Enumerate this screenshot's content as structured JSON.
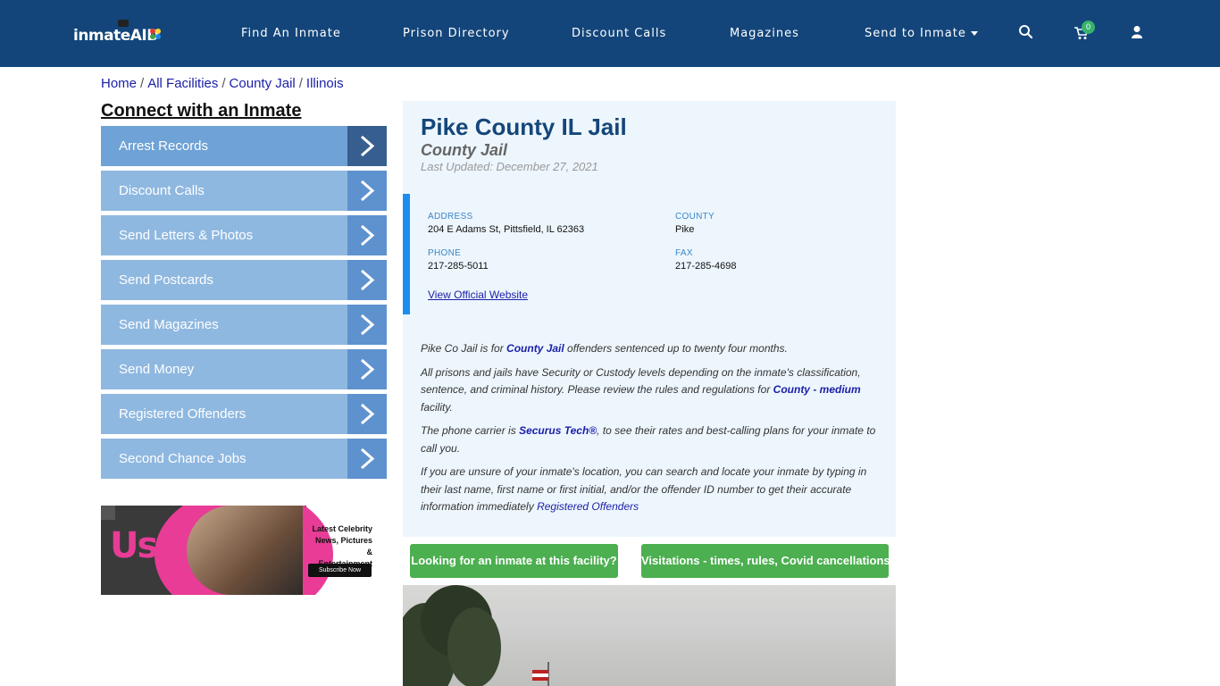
{
  "nav": {
    "logo_text": "inmateAID",
    "links": [
      "Find An Inmate",
      "Prison Directory",
      "Discount Calls",
      "Magazines",
      "Send to Inmate"
    ],
    "cart_count": "0",
    "icons": [
      "search-icon",
      "cart-icon",
      "user-icon"
    ]
  },
  "breadcrumb": [
    "Home",
    "All Facilities",
    "County Jail",
    "Illinois"
  ],
  "sidebar": {
    "title": "Connect with an Inmate",
    "items": [
      {
        "label": "Arrest Records"
      },
      {
        "label": "Discount Calls"
      },
      {
        "label": "Send Letters & Photos"
      },
      {
        "label": "Send Postcards"
      },
      {
        "label": "Send Magazines"
      },
      {
        "label": "Send Money"
      },
      {
        "label": "Registered Offenders"
      },
      {
        "label": "Second Chance Jobs"
      }
    ]
  },
  "ad": {
    "brand": "Us",
    "copy_line1": "Latest Celebrity",
    "copy_line2": "News, Pictures &",
    "copy_line3": "Entertainment",
    "button": "Subscribe Now"
  },
  "facility": {
    "name": "Pike County IL Jail",
    "type": "County Jail",
    "updated": "Last Updated: December 27, 2021",
    "address_label": "ADDRESS",
    "address": "204 E Adams St, Pittsfield, IL 62363",
    "county_label": "COUNTY",
    "county": "Pike",
    "phone_label": "PHONE",
    "phone": "217-285-5011",
    "fax_label": "FAX",
    "fax": "217-285-4698",
    "website_link": "View Official Website"
  },
  "description": {
    "p1_pre": "Pike Co Jail is for ",
    "p1_link": "County Jail",
    "p1_post": " offenders sentenced up to twenty four months.",
    "p2_pre": "All prisons and jails have Security or Custody levels depending on the inmate's classification, sentence, and criminal history. Please review the rules and regulations for ",
    "p2_link": "County - medium",
    "p2_post": " facility.",
    "p3_pre": "The phone carrier is ",
    "p3_link": "Securus Tech®",
    "p3_post": ", to see their rates and best-calling plans for your inmate to call you.",
    "p4_pre": "If you are unsure of your inmate's location, you can search and locate your inmate by typing in their last name, first name or first initial, and/or the offender ID number to get their accurate information immediately ",
    "p4_link": "Registered Offenders"
  },
  "buttons": {
    "find_inmate": "Looking for an inmate at this facility?",
    "visitation": "Visitations - times, rules, Covid cancellations"
  },
  "colors": {
    "nav_bg": "#13457a",
    "side_item": "#8fb8e0",
    "side_arrow": "#5e92cf",
    "card_bg": "#edf6fd",
    "accent_bar": "#1c8df0",
    "green": "#4caf50"
  }
}
